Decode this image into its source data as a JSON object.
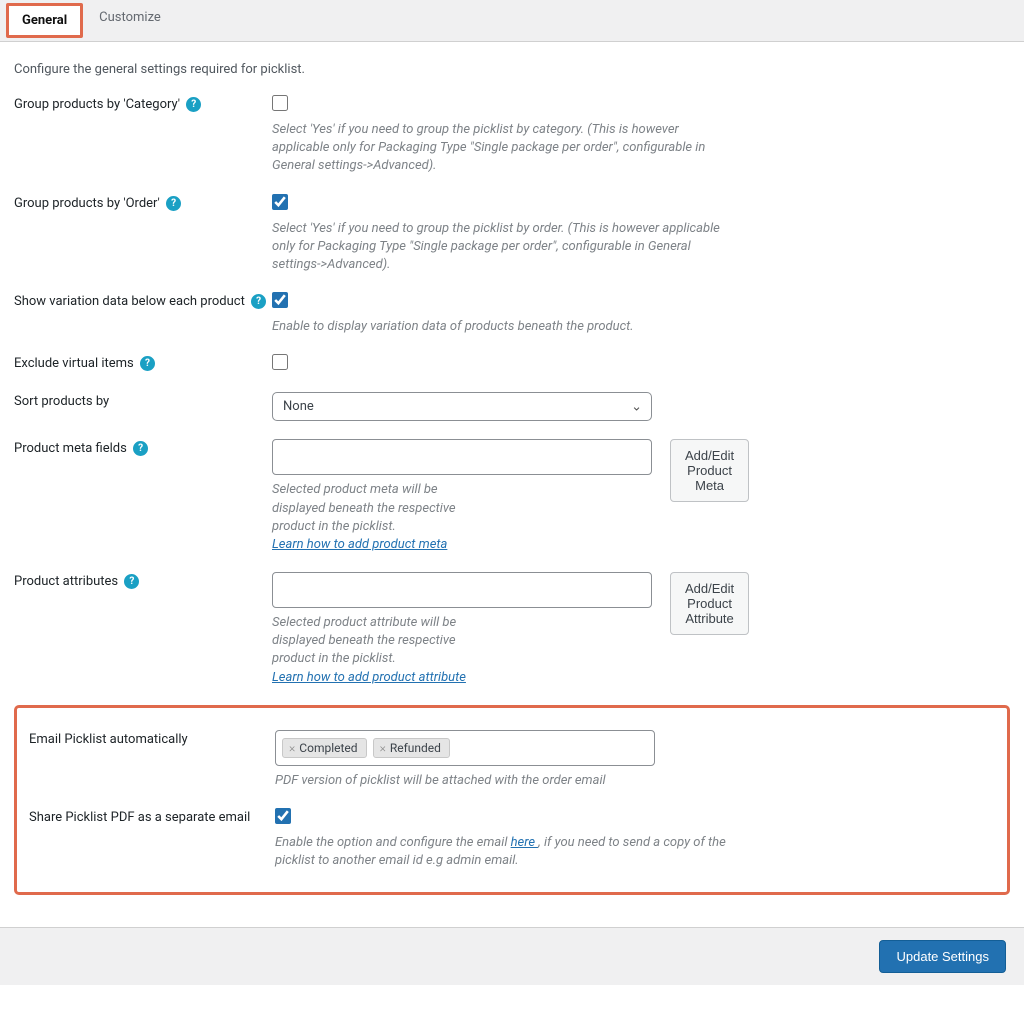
{
  "tabs": {
    "general": "General",
    "customize": "Customize"
  },
  "intro": "Configure the general settings required for picklist.",
  "rows": {
    "group_category": {
      "label": "Group products by 'Category'",
      "desc": "Select 'Yes' if you need to group the picklist by category. (This is however applicable only for Packaging Type \"Single package per order\", configurable in General settings->Advanced)."
    },
    "group_order": {
      "label": "Group products by 'Order'",
      "desc": "Select 'Yes' if you need to group the picklist by order. (This is however applicable only for Packaging Type \"Single package per order\", configurable in General settings->Advanced)."
    },
    "variation": {
      "label": "Show variation data below each product",
      "desc": "Enable to display variation data of products beneath the product."
    },
    "exclude_virtual": {
      "label": "Exclude virtual items"
    },
    "sort": {
      "label": "Sort products by",
      "selected": "None"
    },
    "meta": {
      "label": "Product meta fields",
      "desc": "Selected product meta will be displayed beneath the respective product in the picklist.",
      "link": "Learn how to add product meta",
      "button": "Add/Edit Product Meta"
    },
    "attr": {
      "label": "Product attributes",
      "desc": "Selected product attribute will be displayed beneath the respective product in the picklist.",
      "link": "Learn how to add product attribute",
      "button": "Add/Edit Product Attribute"
    },
    "email_auto": {
      "label": "Email Picklist automatically",
      "tags": [
        "Completed",
        "Refunded"
      ],
      "desc": "PDF version of picklist will be attached with the order email"
    },
    "share_pdf": {
      "label": "Share Picklist PDF as a separate email",
      "desc_pre": "Enable the option and configure the email ",
      "desc_link": "here ",
      "desc_post": ", if you need to send a copy of the picklist to another email id e.g admin email."
    }
  },
  "footer": {
    "save": "Update Settings"
  }
}
